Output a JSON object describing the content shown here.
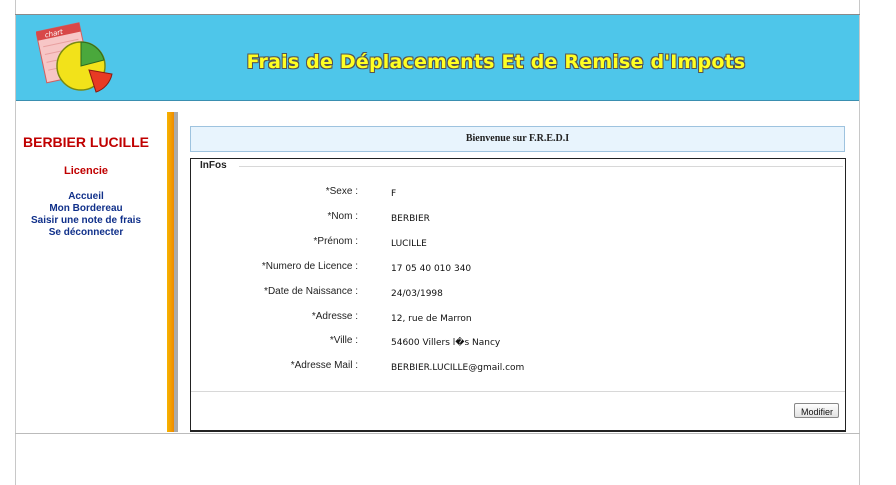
{
  "header": {
    "title": "Frais de Déplacements Et de Remise d'Impots",
    "logo_text": "chart",
    "colors": {
      "background": "#4ec6ea",
      "title": "#ffff22"
    }
  },
  "sidebar": {
    "user_name": "BERBIER LUCILLE",
    "role": "Licencie",
    "nav": [
      {
        "label": "Accueil"
      },
      {
        "label": "Mon Bordereau"
      },
      {
        "label": "Saisir une note de frais"
      },
      {
        "label": "Se déconnecter"
      }
    ]
  },
  "main": {
    "welcome": "Bienvenue sur F.R.E.D.I",
    "infos": {
      "legend": "InFos",
      "fields": [
        {
          "label": "*Sexe :",
          "value": "F"
        },
        {
          "label": "*Nom :",
          "value": "BERBIER"
        },
        {
          "label": "*Prénom :",
          "value": "LUCILLE"
        },
        {
          "label": "*Numero de Licence :",
          "value": "17 05 40 010 340"
        },
        {
          "label": "*Date de Naissance :",
          "value": "24/03/1998"
        },
        {
          "label": "*Adresse :",
          "value": "12, rue de Marron"
        },
        {
          "label": "*Ville :",
          "value": "54600 Villers l�s Nancy"
        },
        {
          "label": "*Adresse Mail :",
          "value": "BERBIER.LUCILLE@gmail.com"
        }
      ],
      "modify_label": "Modifier"
    }
  }
}
